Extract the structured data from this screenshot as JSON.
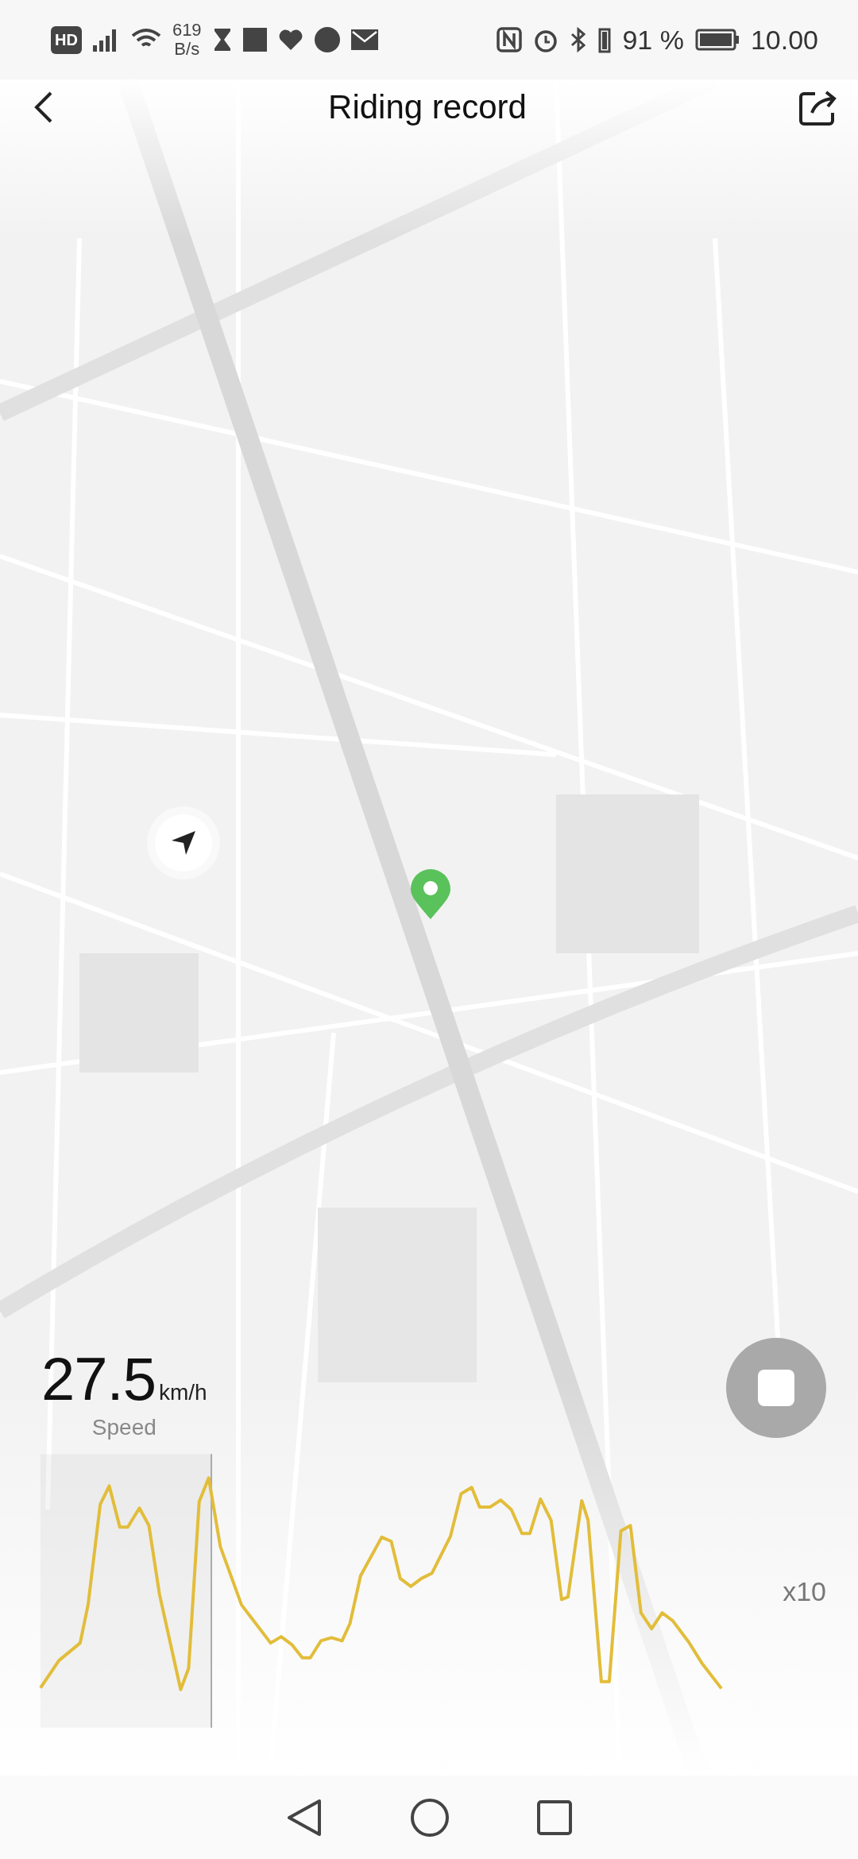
{
  "status_bar": {
    "network_label": "HD",
    "data_rate": "619",
    "data_rate_unit": "B/s",
    "battery_percent": "91 %",
    "time": "10.00"
  },
  "header": {
    "title": "Riding record"
  },
  "speed": {
    "value": "27.5",
    "unit": "km/h",
    "label": "Speed"
  },
  "chart": {
    "zoom_label": "x10"
  }
}
